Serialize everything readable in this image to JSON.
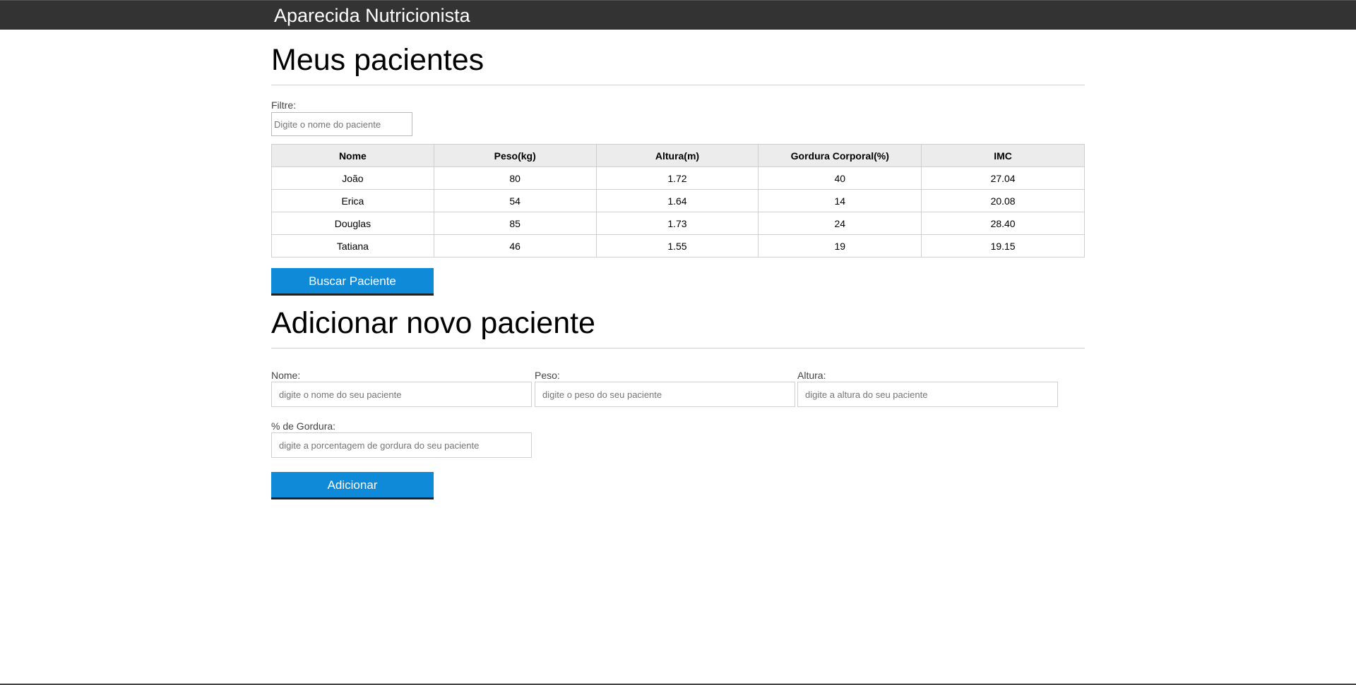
{
  "header": {
    "brand": "Aparecida Nutricionista"
  },
  "patients_section": {
    "title": "Meus pacientes",
    "filter_label": "Filtre:",
    "filter_placeholder": "Digite o nome do paciente",
    "columns": [
      "Nome",
      "Peso(kg)",
      "Altura(m)",
      "Gordura Corporal(%)",
      "IMC"
    ],
    "rows": [
      [
        "João",
        "80",
        "1.72",
        "40",
        "27.04"
      ],
      [
        "Erica",
        "54",
        "1.64",
        "14",
        "20.08"
      ],
      [
        "Douglas",
        "85",
        "1.73",
        "24",
        "28.40"
      ],
      [
        "Tatiana",
        "46",
        "1.55",
        "19",
        "19.15"
      ]
    ],
    "search_button": "Buscar Paciente"
  },
  "add_section": {
    "title": "Adicionar novo paciente",
    "fields": {
      "nome": {
        "label": "Nome:",
        "placeholder": "digite o nome do seu paciente"
      },
      "peso": {
        "label": "Peso:",
        "placeholder": "digite o peso do seu paciente"
      },
      "altura": {
        "label": "Altura:",
        "placeholder": "digite a altura do seu paciente"
      },
      "gordura": {
        "label": "% de Gordura:",
        "placeholder": "digite a porcentagem de gordura do seu paciente"
      }
    },
    "submit_button": "Adicionar"
  },
  "colors": {
    "header_bg": "#333333",
    "button_bg": "#0e8ad8",
    "table_header_bg": "#ececec"
  }
}
